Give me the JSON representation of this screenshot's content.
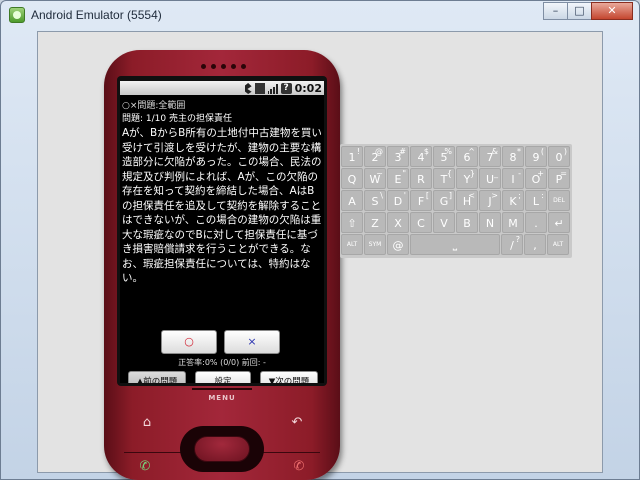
{
  "window": {
    "title": "Android Emulator (5554)",
    "buttons": {
      "minimize": "–",
      "maximize": "□",
      "close": "✕"
    }
  },
  "status_bar": {
    "time": "0:02",
    "icons": [
      "bluetooth-icon",
      "network-3g-icon",
      "signal-icon",
      "battery-icon"
    ],
    "battery_glyph": "?"
  },
  "app": {
    "title": "○×問題:全範囲",
    "question_header": "問題: 1/10 売主の担保責任",
    "question_text": "Aが、BからB所有の土地付中古建物を買い受けて引渡しを受けたが、建物の主要な構造部分に欠陥があった。この場合、民法の規定及び判例によれば、Aが、この欠陥の存在を知って契約を締結した場合、AはBの担保責任を追及して契約を解除することはできないが、この場合の建物の欠陥は重大な瑕疵なのでBに対して担保責任に基づき損害賠償請求を行うことができる。なお、瑕疵担保責任については、特約はない。",
    "answer_true": "○",
    "answer_false": "×",
    "score_text": "正答率:0% (0/0) 前回: -",
    "prev_button": "▲前の問題",
    "settings_button": "設定",
    "next_button": "▼次の問題"
  },
  "phone": {
    "menu_label": "MENU",
    "home_icon": "⌂",
    "back_icon": "↶",
    "call_icon": "✆",
    "end_icon": "✆"
  },
  "keyboard": {
    "rows": [
      [
        {
          "main": "1",
          "alt": "!"
        },
        {
          "main": "2",
          "alt": "@"
        },
        {
          "main": "3",
          "alt": "#"
        },
        {
          "main": "4",
          "alt": "$"
        },
        {
          "main": "5",
          "alt": "%"
        },
        {
          "main": "6",
          "alt": "^"
        },
        {
          "main": "7",
          "alt": "&"
        },
        {
          "main": "8",
          "alt": "*"
        },
        {
          "main": "9",
          "alt": "("
        },
        {
          "main": "0",
          "alt": ")"
        }
      ],
      [
        {
          "main": "Q",
          "alt": ""
        },
        {
          "main": "W",
          "alt": "~"
        },
        {
          "main": "E",
          "alt": "\""
        },
        {
          "main": "R",
          "alt": ""
        },
        {
          "main": "T",
          "alt": "{"
        },
        {
          "main": "Y",
          "alt": "}"
        },
        {
          "main": "U",
          "alt": "_"
        },
        {
          "main": "I",
          "alt": "-"
        },
        {
          "main": "O",
          "alt": "+"
        },
        {
          "main": "P",
          "alt": "="
        }
      ],
      [
        {
          "main": "A",
          "alt": ""
        },
        {
          "main": "S",
          "alt": "\\"
        },
        {
          "main": "D",
          "alt": "'"
        },
        {
          "main": "F",
          "alt": "["
        },
        {
          "main": "G",
          "alt": "]"
        },
        {
          "main": "H",
          "alt": "<"
        },
        {
          "main": "J",
          "alt": ">"
        },
        {
          "main": "K",
          "alt": ";"
        },
        {
          "main": "L",
          "alt": ":"
        },
        {
          "main": "DEL",
          "alt": ""
        }
      ],
      [
        {
          "main": "⇧",
          "alt": ""
        },
        {
          "main": "Z",
          "alt": ""
        },
        {
          "main": "X",
          "alt": ""
        },
        {
          "main": "C",
          "alt": ""
        },
        {
          "main": "V",
          "alt": ""
        },
        {
          "main": "B",
          "alt": ""
        },
        {
          "main": "N",
          "alt": ""
        },
        {
          "main": "M",
          "alt": ""
        },
        {
          "main": ".",
          "alt": ""
        },
        {
          "main": "↵",
          "alt": ""
        }
      ],
      [
        {
          "main": "ALT",
          "alt": ""
        },
        {
          "main": "SYM",
          "alt": ""
        },
        {
          "main": "@",
          "alt": ""
        },
        {
          "main": "⎵",
          "alt": ""
        },
        {
          "main": "/",
          "alt": "?"
        },
        {
          "main": ",",
          "alt": ""
        },
        {
          "main": "ALT",
          "alt": ""
        }
      ]
    ]
  }
}
